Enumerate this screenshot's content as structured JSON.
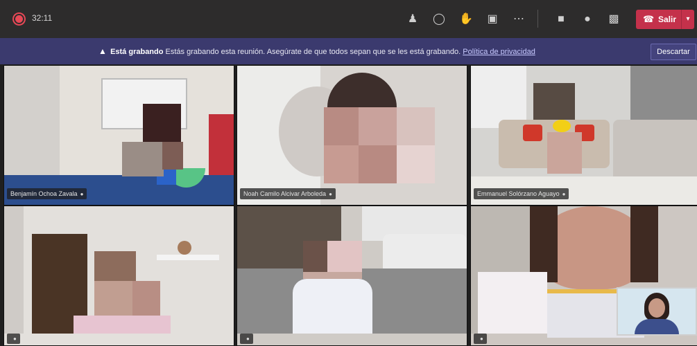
{
  "toolbar": {
    "timer": "32:11",
    "leave_label": "Salir"
  },
  "banner": {
    "title": "Está grabando",
    "message": "Estás grabando esta reunión. Asegúrate de que todos sepan que se les está grabando.",
    "policy_link": "Política de privacidad",
    "dismiss_label": "Descartar"
  },
  "participants": [
    {
      "name": "Benjamín Ochoa Zavala"
    },
    {
      "name": "Noah Camilo Alcivar Arboleda"
    },
    {
      "name": "Emmanuel Solórzano Aguayo"
    },
    {
      "name": ""
    },
    {
      "name": ""
    },
    {
      "name": ""
    }
  ],
  "icons": {
    "record": "record-indicator-icon",
    "people": "people-icon",
    "chat": "chat-icon",
    "reactions": "raise-hand-icon",
    "rooms": "breakout-rooms-icon",
    "more": "more-actions-icon",
    "camera": "camera-icon",
    "mic": "microphone-icon",
    "share": "share-screen-icon",
    "leave": "phone-hangup-icon",
    "warning": "warning-icon"
  },
  "colors": {
    "topbar": "#2d2c2c",
    "banner": "#3b3a6e",
    "leave": "#c4314b",
    "record": "#e74856"
  }
}
